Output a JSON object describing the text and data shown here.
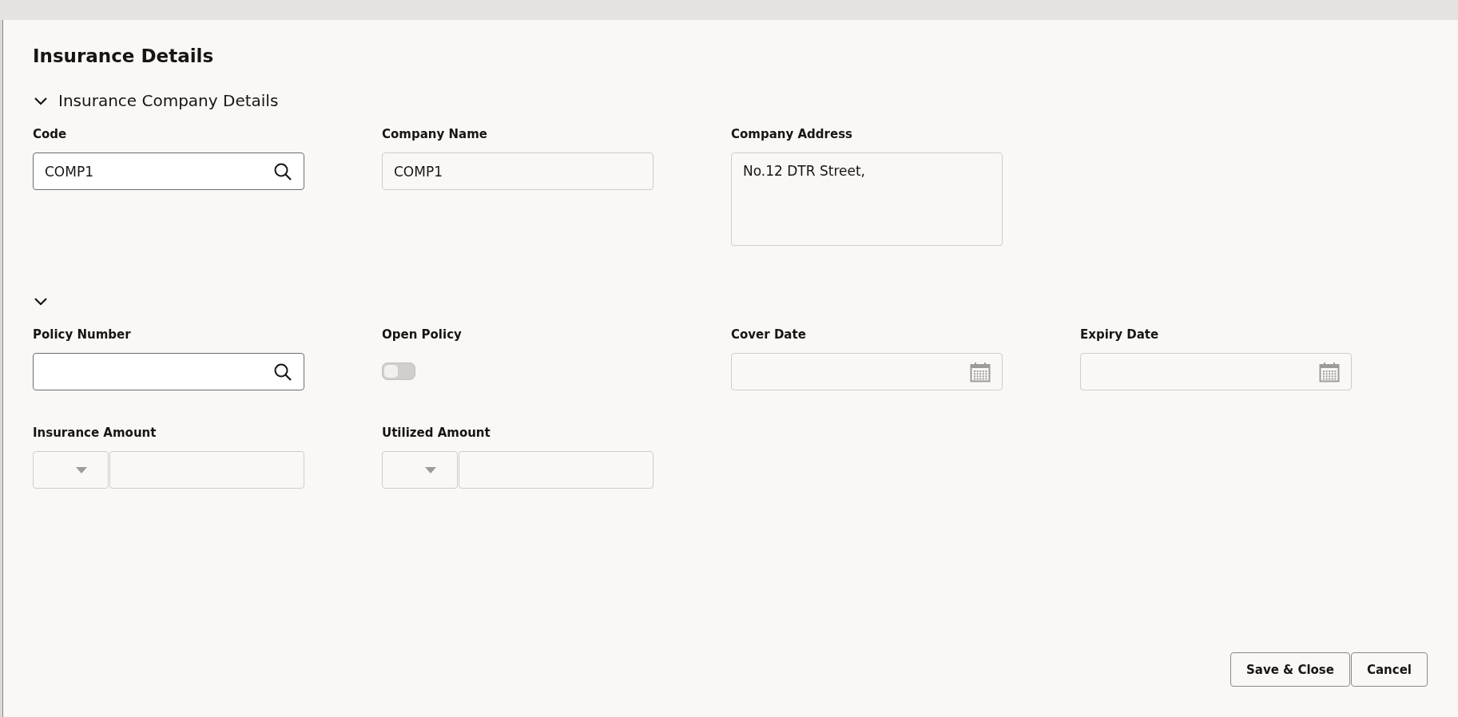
{
  "dialog": {
    "title": "Insurance Details"
  },
  "sections": [
    {
      "title": "Insurance Company Details",
      "expanded": true,
      "fields": [
        {
          "kind": "search",
          "label": "Code",
          "value": "COMP1",
          "disabled": false
        },
        {
          "kind": "text",
          "label": "Company Name",
          "value": "COMP1",
          "disabled": true
        },
        {
          "kind": "textarea",
          "label": "Company Address",
          "value": "No.12 DTR Street,",
          "disabled": true
        }
      ]
    },
    {
      "expanded": true,
      "fields": [
        {
          "kind": "search",
          "label": "Policy Number",
          "disabled": false
        },
        {
          "kind": "toggle",
          "label": "Open Policy",
          "on": false,
          "disabled": true
        },
        {
          "kind": "date",
          "label": "Cover Date",
          "disabled": true
        },
        {
          "kind": "date",
          "label": "Expiry Date",
          "disabled": true
        },
        {
          "kind": "amount",
          "label": "Insurance Amount",
          "disabled": true
        },
        {
          "kind": "amount",
          "label": "Utilized Amount",
          "disabled": true
        }
      ]
    }
  ],
  "buttons": [
    {
      "label": "Save & Close"
    },
    {
      "label": "Cancel"
    }
  ]
}
